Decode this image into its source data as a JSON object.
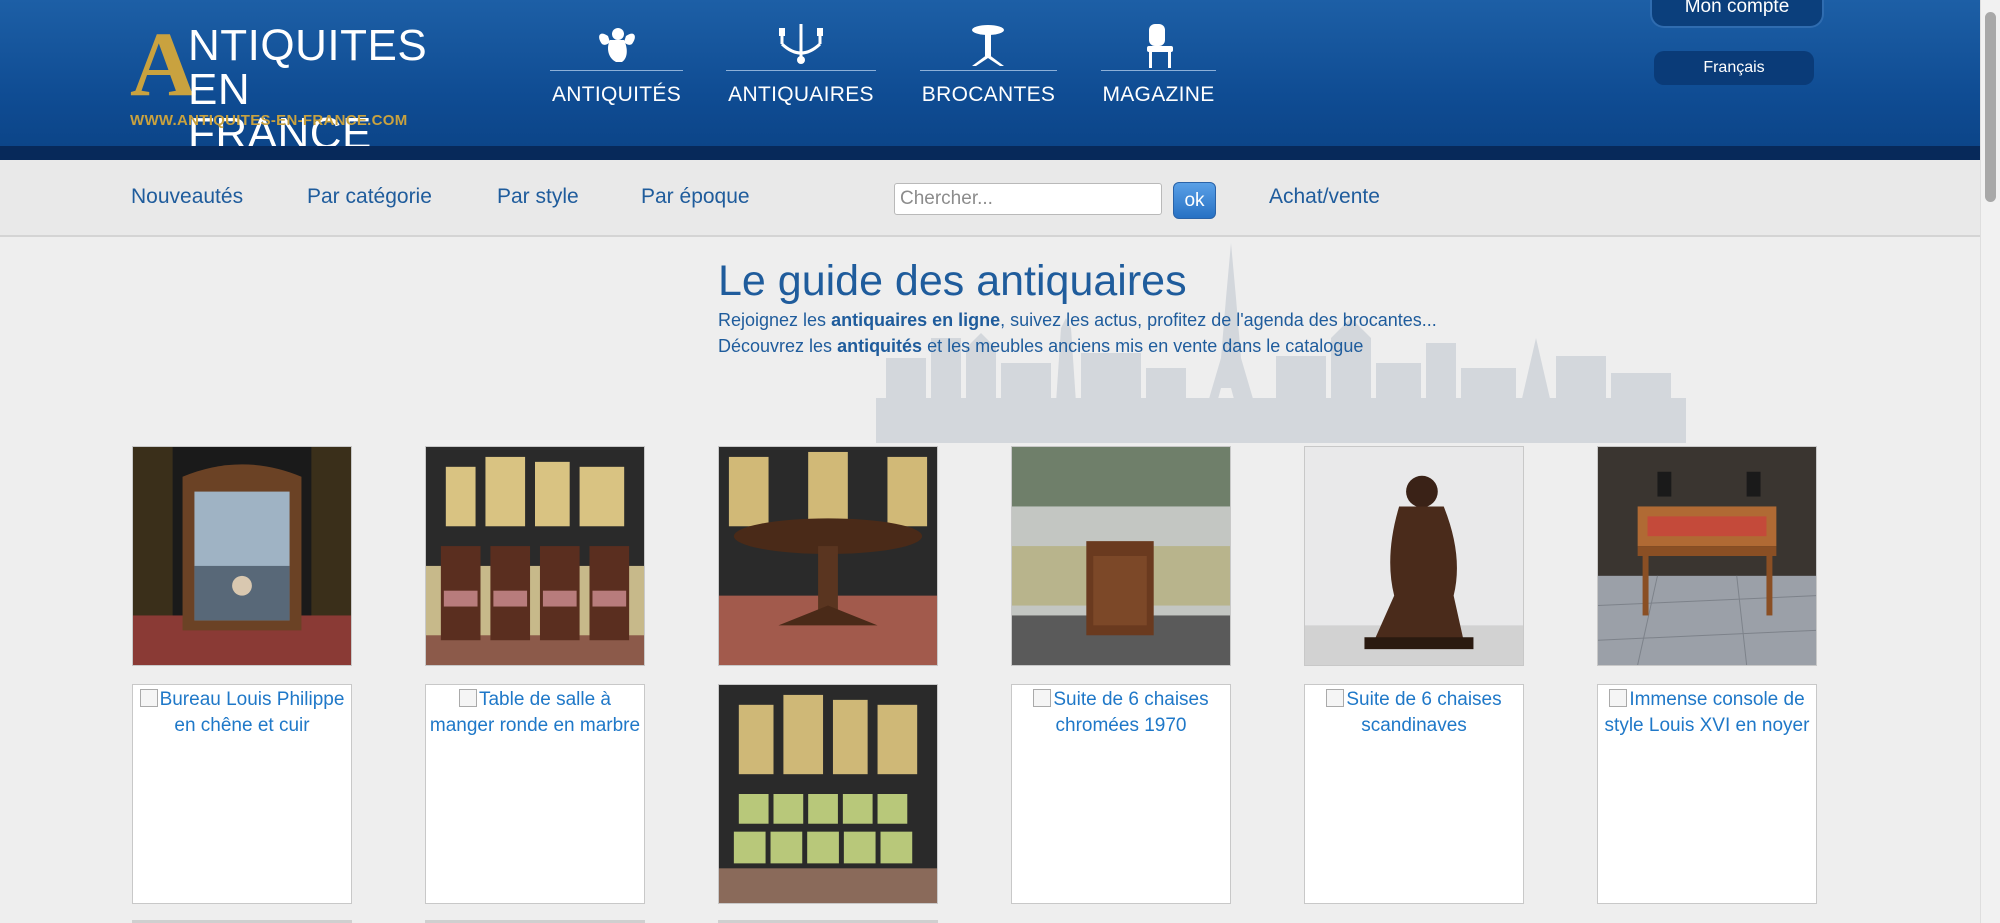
{
  "header": {
    "logo": {
      "big_letter": "A",
      "line1": "NTIQUITES",
      "line2": "EN FRANCE",
      "url": "WWW.ANTIQUITES-EN-FRANCE.COM"
    },
    "nav": [
      {
        "label": "ANTIQUITÉS",
        "icon": "angel-icon"
      },
      {
        "label": "ANTIQUAIRES",
        "icon": "chandelier-icon"
      },
      {
        "label": "BROCANTES",
        "icon": "pedestal-table-icon"
      },
      {
        "label": "MAGAZINE",
        "icon": "chair-icon"
      }
    ],
    "account_label": "Mon compte",
    "language_label": "Français"
  },
  "subnav": {
    "items": [
      "Nouveautés",
      "Par catégorie",
      "Par style",
      "Par époque"
    ],
    "search_placeholder": "Chercher...",
    "search_button": "ok",
    "buy_sell": "Achat/vente"
  },
  "guide": {
    "title": "Le guide des antiquaires",
    "line1_pre": "Rejoignez les ",
    "line1_bold": "antiquaires en ligne",
    "line1_post": ", suivez les actus, profitez de l'agenda des brocantes...",
    "line2_pre": "Découvrez les ",
    "line2_bold": "antiquités",
    "line2_post": " et les meubles anciens mis en vente dans le catalogue"
  },
  "products_row1": [
    {
      "image": "carved-mirror"
    },
    {
      "image": "four-chairs"
    },
    {
      "image": "round-table"
    },
    {
      "image": "small-cabinet"
    },
    {
      "image": "bronze-statue"
    },
    {
      "image": "cylinder-desk"
    }
  ],
  "products_row2": [
    {
      "alt": "Bureau Louis Philippe en chêne et cuir"
    },
    {
      "alt": "Table de salle à manger ronde en marbre"
    },
    {
      "image": "green-chairs"
    },
    {
      "alt": "Suite de 6 chaises chromées 1970"
    },
    {
      "alt": "Suite de 6 chaises scandinaves"
    },
    {
      "alt": "Immense console de style Louis XVI en noyer"
    }
  ],
  "colors": {
    "header_blue": "#0f4c93",
    "header_strip": "#07295a",
    "gold": "#c9a23f",
    "link_blue": "#1f5c9c",
    "alt_text_blue": "#1f78c8"
  }
}
